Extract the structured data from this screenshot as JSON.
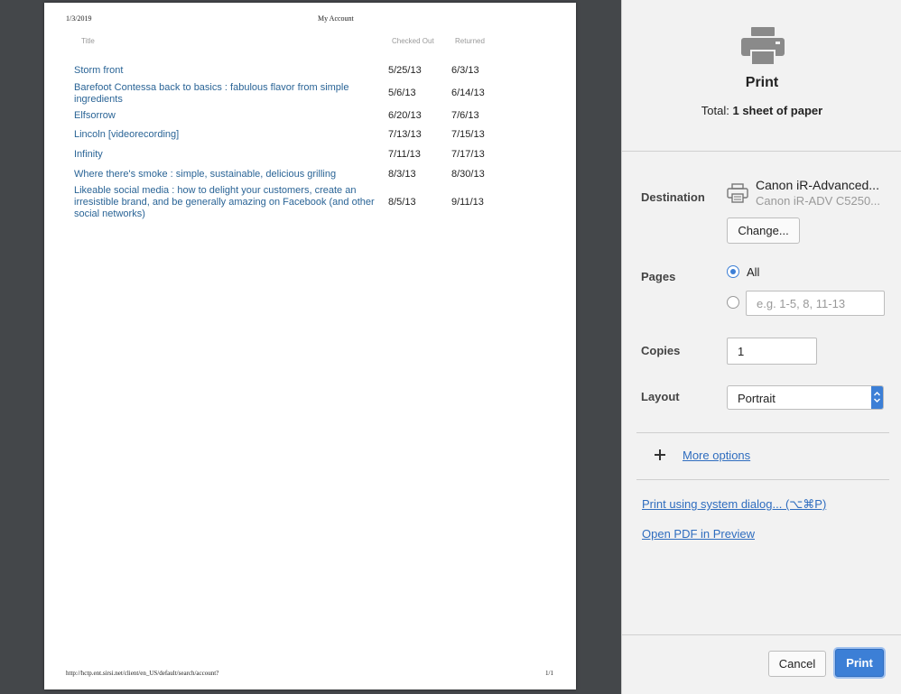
{
  "page": {
    "date": "1/3/2019",
    "title": "My Account",
    "columns": {
      "title": "Title",
      "checked_out": "Checked Out",
      "returned": "Returned"
    },
    "rows": [
      {
        "title": "Storm front",
        "checked_out": "5/25/13",
        "returned": "6/3/13"
      },
      {
        "title": "Barefoot Contessa back to basics : fabulous flavor from simple ingredients",
        "checked_out": "5/6/13",
        "returned": "6/14/13"
      },
      {
        "title": "Elfsorrow",
        "checked_out": "6/20/13",
        "returned": "7/6/13"
      },
      {
        "title": "Lincoln [videorecording]",
        "checked_out": "7/13/13",
        "returned": "7/15/13"
      },
      {
        "title": "Infinity",
        "checked_out": "7/11/13",
        "returned": "7/17/13"
      },
      {
        "title": "Where there's smoke : simple, sustainable, delicious grilling",
        "checked_out": "8/3/13",
        "returned": "8/30/13"
      },
      {
        "title": "Likeable social media : how to delight your customers, create an irresistible brand, and be generally amazing on Facebook (and other social networks)",
        "checked_out": "8/5/13",
        "returned": "9/11/13"
      }
    ],
    "footer_url": "http://hctp.ent.sirsi.net/client/en_US/default/search/account?",
    "page_number": "1/1"
  },
  "sidebar": {
    "title": "Print",
    "total_prefix": "Total: ",
    "total_value": "1 sheet of paper",
    "destination_label": "Destination",
    "destination_name": "Canon iR-Advanced...",
    "destination_model": "Canon iR-ADV C5250...",
    "change_button": "Change...",
    "pages_label": "Pages",
    "pages_all": "All",
    "pages_placeholder": "e.g. 1-5, 8, 11-13",
    "copies_label": "Copies",
    "copies_value": "1",
    "layout_label": "Layout",
    "layout_value": "Portrait",
    "more_options": "More options",
    "system_dialog": "Print using system dialog... (⌥⌘P)",
    "open_pdf": "Open PDF in Preview",
    "cancel_button": "Cancel",
    "print_button": "Print"
  },
  "colors": {
    "accent": "#3c7fd6",
    "link": "#2f6dbf",
    "doc_link": "#2a6496"
  },
  "icons": {
    "header": "printer-icon",
    "destination": "printer-icon",
    "more": "plus-icon",
    "select": "chevron-down-icon"
  }
}
